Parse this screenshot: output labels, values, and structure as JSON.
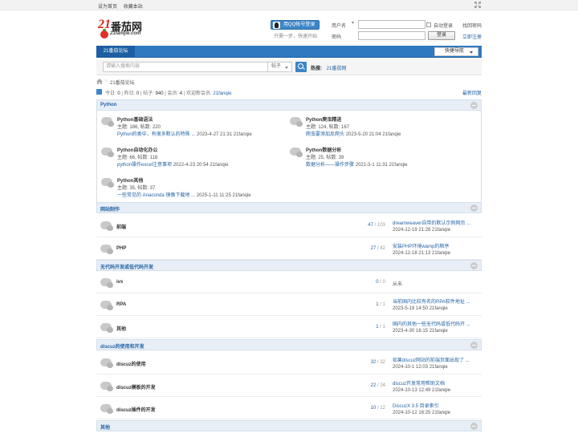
{
  "topbar": {
    "set_home": "设为首页",
    "bookmark": "收藏本站"
  },
  "logo": {
    "number": "21",
    "name": "番茄网",
    "domain": "21fanqie.com"
  },
  "qq_login": {
    "button": "用QQ帐号登录",
    "tip": "只需一步，快速开始"
  },
  "login": {
    "username_label": "用户名",
    "password_label": "密码",
    "auto_login": "自动登录",
    "forgot": "找回密码",
    "login_button": "登录",
    "register": "立即注册"
  },
  "nav": {
    "forum_tab": "21番茄论坛",
    "quick_nav": "快捷导航"
  },
  "search": {
    "placeholder": "请输入搜索内容",
    "select": "帖子",
    "hot_label": "热搜:",
    "hot_item": "21番茄网"
  },
  "breadcrumb": {
    "label": "21番茄论坛"
  },
  "stats": {
    "today_label": "今日:",
    "today": "0",
    "yesterday_label": "昨日:",
    "yesterday": "0",
    "posts_label": "帖子:",
    "posts": "940",
    "members_label": "会员:",
    "members": "4",
    "welcome_label": "欢迎新会员:",
    "new_member": "21fanqie",
    "latest_reply": "最新回复"
  },
  "sections": {
    "python": {
      "title": "Python",
      "forums": [
        {
          "name": "Python基础语法",
          "stats": "主题: 186, 帖数: 220",
          "last_title": "Python的类中，有很多默认的特殊 ...",
          "last_info": "2023-4-27 21:31 21fanqie"
        },
        {
          "name": "Python爬虫精进",
          "stats": "主题: 124, 帖数: 167",
          "last_title": "爬虫要添加反爬头",
          "last_info": "2023-5-20 21:04 21fanqie"
        },
        {
          "name": "Python自动化办公",
          "stats": "主题: 66, 帖数: 118",
          "last_title": "python操作excel注意事项",
          "last_info": "2022-4-23 20:54 21fanqie"
        },
        {
          "name": "Python数据分析",
          "stats": "主题: 25, 帖数: 39",
          "last_title": "数据分析——操作步骤",
          "last_info": "2021-3-1 11:31 21fanqie"
        },
        {
          "name": "Python其他",
          "stats": "主题: 35, 帖数: 37",
          "last_title": "一些常见的 Anaconda 镜像下载地 ...",
          "last_info": "2025-1-11 11:25 21fanqie"
        }
      ]
    },
    "webmaking": {
      "title": "网站制作",
      "forums": [
        {
          "name": "前端",
          "threads": "47",
          "posts": "103",
          "last_title": "dreamweaver自带的默认示例网页 ...",
          "last_info": "2024-12-19 21:28 21fanqie"
        },
        {
          "name": "PHP",
          "threads": "27",
          "posts": "42",
          "last_title": "安装PHP环境wamp的顺序",
          "last_info": "2024-12-18 21:13 21fanqie"
        }
      ]
    },
    "nocode": {
      "title": "无代码开发或低代码开发",
      "forums": [
        {
          "name": "ivx",
          "threads": "0",
          "posts": "0",
          "last_title": "从未",
          "last_info": ""
        },
        {
          "name": "RPA",
          "threads": "1",
          "posts": "1",
          "last_title": "当前国内比较有名的RPA软件地址 ...",
          "last_info": "2023-5-19 14:50 21fanqie"
        },
        {
          "name": "其他",
          "threads": "1",
          "posts": "1",
          "last_title": "国内的其他一些无代码或低代码开 ...",
          "last_info": "2023-4-30 16:15 21fanqie"
        }
      ]
    },
    "discuz": {
      "title": "discuz的使用和开发",
      "forums": [
        {
          "name": "discuz的使用",
          "threads": "32",
          "posts": "32",
          "last_title": "如果discuz网站的前端页面出现了 ...",
          "last_info": "2024-10-1 12:03 21fanqie"
        },
        {
          "name": "discuz模板的开发",
          "threads": "22",
          "posts": "24",
          "last_title": "discuz开发常用帮助文档",
          "last_info": "2024-10-13 12:49 21fanqie"
        },
        {
          "name": "discuz插件的开发",
          "threads": "10",
          "posts": "12",
          "last_title": "DiscuzX 3.5 目录索引",
          "last_info": "2024-10-12 16:25 21fanqie"
        }
      ]
    },
    "other": {
      "title": "其他"
    }
  }
}
